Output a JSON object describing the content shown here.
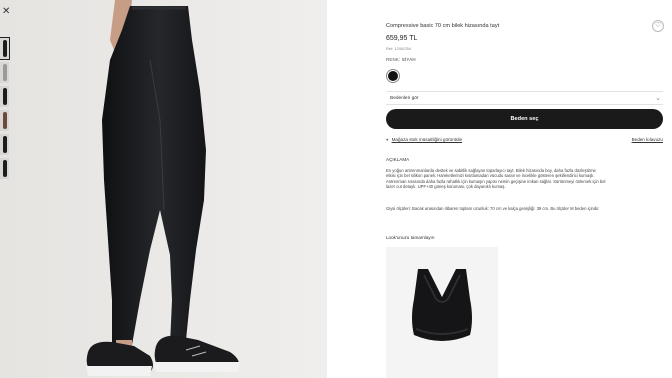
{
  "gallery": {
    "close_icon": "close-icon",
    "thumbnails": [
      "black-front",
      "grey",
      "black-side",
      "skin-top",
      "black-back",
      "black-full"
    ]
  },
  "product": {
    "title": "Compressive basic 70 cm bilek hizasında tayt",
    "price": "659,95 TL",
    "ref": "Ref: 1206/254",
    "color_label": "RENK:",
    "color_value": "SİYAH",
    "selected_color": "#111111",
    "size_placeholder": "Bedenleri gör",
    "choose_size_label": "Beden seç",
    "store_stock_link": "Mağaza stok müsaitliğini görüntüle",
    "size_guide_link": "Beden kılavuzu",
    "description_heading": "AÇIKLAMA",
    "description_1": "En yoğun antrenmanlarda destek ve sabitlik sağlayan toparlayıcı tayt. Bilek hizasında boy, daha fazla düzleştirme etkisi için bel silikon paneli. Hareketlerinizi kısıtlamadan vücudu saran ve incelikle gösteren şekillendirici kumaşlı. Antrenman sırasında daha fazla rahatlık için kumaşın yapısı nemin geçişine imkan sağlar. Sürtünmeyi önlemek için bel lazer cut detaylı. UPF+40 güneş koruması, çok dayanıklı kumaş.",
    "description_2": "Giysi ölçüleri: Bacak arasından itibaren toplam uzunluk: 70 cm ve kalça genişliği: 39 cm. Bu ölçüler M beden içindir.",
    "look_heading": "Look'unuzu tamamlayın"
  },
  "icons": {
    "favorite": "heart-icon",
    "pin": "location-pin-icon",
    "chevron": "chevron-down-icon"
  }
}
